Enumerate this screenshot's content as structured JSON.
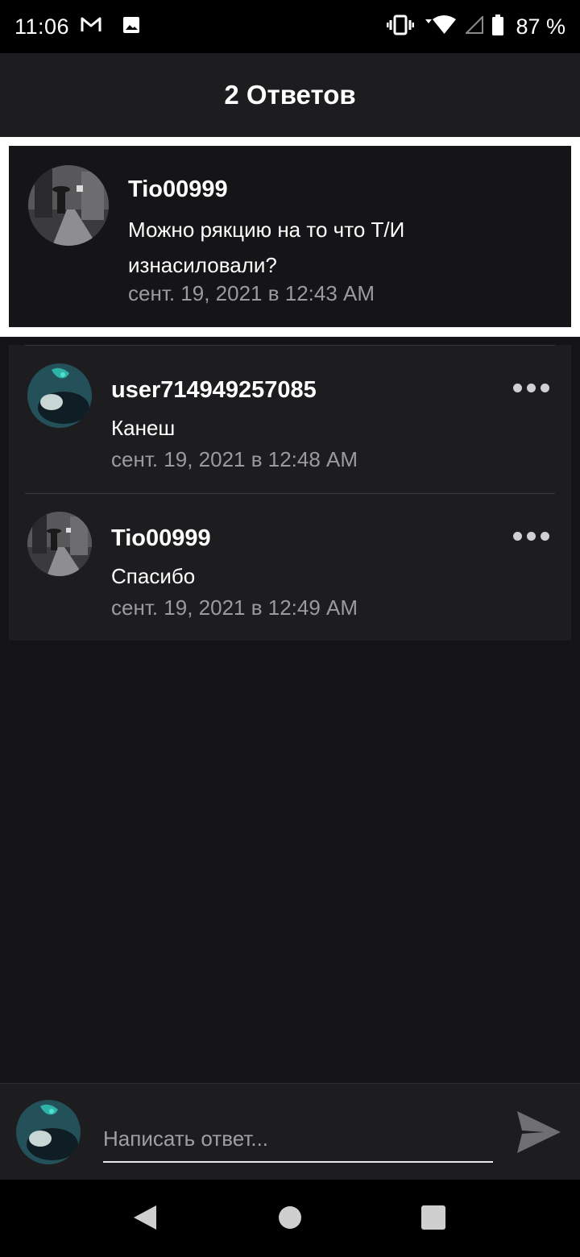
{
  "status_bar": {
    "time": "11:06",
    "battery_text": "87 %",
    "icons": [
      "gmail-icon",
      "image-icon",
      "vibrate-icon",
      "wifi-icon",
      "signal-icon",
      "battery-icon"
    ]
  },
  "header": {
    "title": "2 Ответов"
  },
  "parent_comment": {
    "username": "Tio00999",
    "text": "Можно рякцию на то что Т/И изнасиловали?",
    "timestamp": "сент. 19, 2021 в 12:43 AM"
  },
  "replies": [
    {
      "username": "user714949257085",
      "text": "Канеш",
      "timestamp": "сент. 19, 2021 в 12:48 AM"
    },
    {
      "username": "Tio00999",
      "text": "Спасибо",
      "timestamp": "сент. 19, 2021 в 12:49 AM"
    }
  ],
  "composer": {
    "placeholder": "Написать ответ..."
  },
  "colors": {
    "background": "#141316",
    "card": "#1d1c1f",
    "timestamp": "#9b9aa0",
    "highlight_border": "#ffffff"
  }
}
